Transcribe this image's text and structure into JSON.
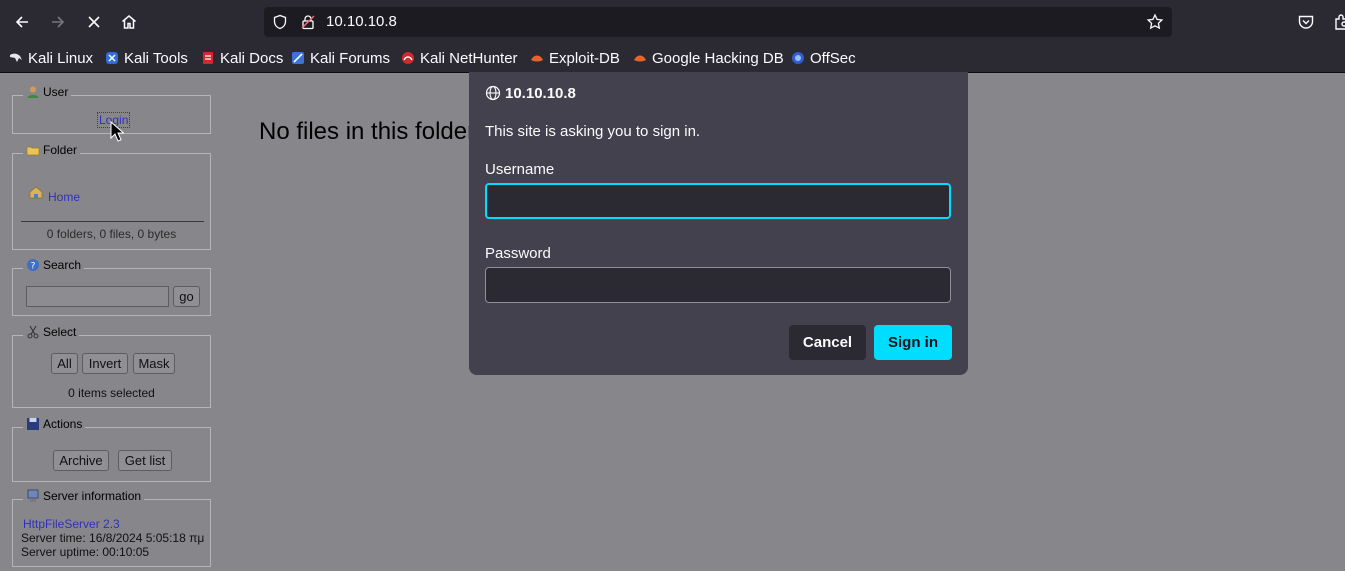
{
  "browser": {
    "url": "10.10.10.8",
    "bookmarks": [
      {
        "label": "Kali Linux",
        "icon": "kali-dragon-icon"
      },
      {
        "label": "Kali Tools",
        "icon": "kali-tools-icon"
      },
      {
        "label": "Kali Docs",
        "icon": "kali-docs-icon"
      },
      {
        "label": "Kali Forums",
        "icon": "kali-forums-icon"
      },
      {
        "label": "Kali NetHunter",
        "icon": "nethunter-icon"
      },
      {
        "label": "Exploit-DB",
        "icon": "exploitdb-icon"
      },
      {
        "label": "Google Hacking DB",
        "icon": "ghdb-icon"
      },
      {
        "label": "OffSec",
        "icon": "offsec-icon"
      }
    ],
    "colors": {
      "chrome": "#2b2a33",
      "urlbar": "#1c1b22",
      "accent": "#00ddff"
    }
  },
  "sidebar": {
    "user": {
      "legend": "User",
      "login_link": "Login"
    },
    "folder": {
      "legend": "Folder",
      "home_link": "Home",
      "summary": "0 folders, 0 files, 0 bytes"
    },
    "search": {
      "legend": "Search",
      "go_label": "go"
    },
    "select": {
      "legend": "Select",
      "all_label": "All",
      "invert_label": "Invert",
      "mask_label": "Mask",
      "status": "0 items selected"
    },
    "actions": {
      "legend": "Actions",
      "archive_label": "Archive",
      "getlist_label": "Get list"
    },
    "server": {
      "legend": "Server information",
      "link": "HttpFileServer 2.3",
      "time": "Server time: 16/8/2024 5:05:18 πμ",
      "uptime": "Server uptime: 00:10:05"
    }
  },
  "main": {
    "empty_message": "No files in this folder"
  },
  "dialog": {
    "host": "10.10.10.8",
    "message": "This site is asking you to sign in.",
    "username_label": "Username",
    "username_value": "",
    "password_label": "Password",
    "password_value": "",
    "cancel_label": "Cancel",
    "signin_label": "Sign in"
  }
}
